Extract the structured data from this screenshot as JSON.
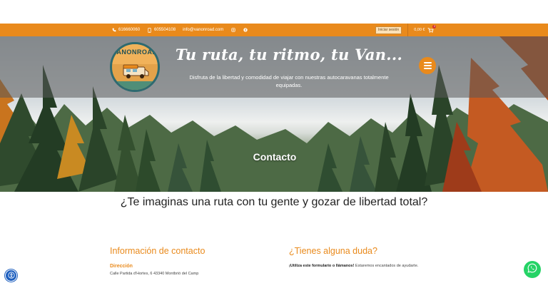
{
  "topbar": {
    "phone": "616660060",
    "mobile": "605504108",
    "email": "info@vanonroad.com",
    "login_label": "Iniciar sesión",
    "cart_total": "0,00 €",
    "cart_count": "0"
  },
  "hero": {
    "logo_text": "VANONROAD",
    "tagline": "Tu ruta, tu ritmo, tu Van...",
    "subtitle": "Disfruta de la libertad y comodidad de viajar con nuestras autocaravanas totalmente equipadas.",
    "page_title": "Contacto"
  },
  "main": {
    "headline": "¿Te imaginas una ruta con tu gente y gozar de libertad total?",
    "contact_info": {
      "title": "Información de contacto",
      "address_label": "Dirección",
      "address": "Calle Partida d'Hortes, 6 43340 Montbrió del Camp"
    },
    "questions": {
      "title": "¿Tienes alguna duda?",
      "note_bold": "¡Utiliza este formulario o llámanos!",
      "note_rest": " Estaremos encantados de ayudarte."
    }
  },
  "colors": {
    "accent": "#e98a1c",
    "whatsapp": "#25d366",
    "accessibility": "#1d5fbf"
  },
  "icons": [
    "phone-icon",
    "mobile-icon",
    "email-icon",
    "instagram-icon",
    "facebook-icon",
    "cart-icon",
    "menu-icon",
    "accessibility-icon",
    "whatsapp-icon"
  ]
}
